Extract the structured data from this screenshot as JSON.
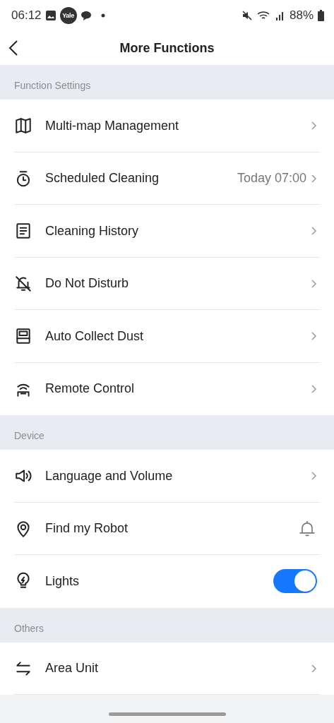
{
  "status_bar": {
    "time": "06:12",
    "notification_badge": "Yale",
    "battery": "88%"
  },
  "header": {
    "title": "More Functions"
  },
  "sections": [
    {
      "title": "Function Settings",
      "items": [
        {
          "label": "Multi-map Management",
          "kind": "link"
        },
        {
          "label": "Scheduled Cleaning",
          "kind": "link",
          "value": "Today 07:00"
        },
        {
          "label": "Cleaning History",
          "kind": "link"
        },
        {
          "label": "Do Not Disturb",
          "kind": "link"
        },
        {
          "label": "Auto Collect Dust",
          "kind": "link"
        },
        {
          "label": "Remote Control",
          "kind": "link"
        }
      ]
    },
    {
      "title": "Device",
      "items": [
        {
          "label": "Language and Volume",
          "kind": "link"
        },
        {
          "label": "Find my Robot",
          "kind": "bell"
        },
        {
          "label": "Lights",
          "kind": "toggle",
          "on": true
        }
      ]
    },
    {
      "title": "Others",
      "items": [
        {
          "label": "Area Unit",
          "kind": "link"
        }
      ]
    }
  ]
}
